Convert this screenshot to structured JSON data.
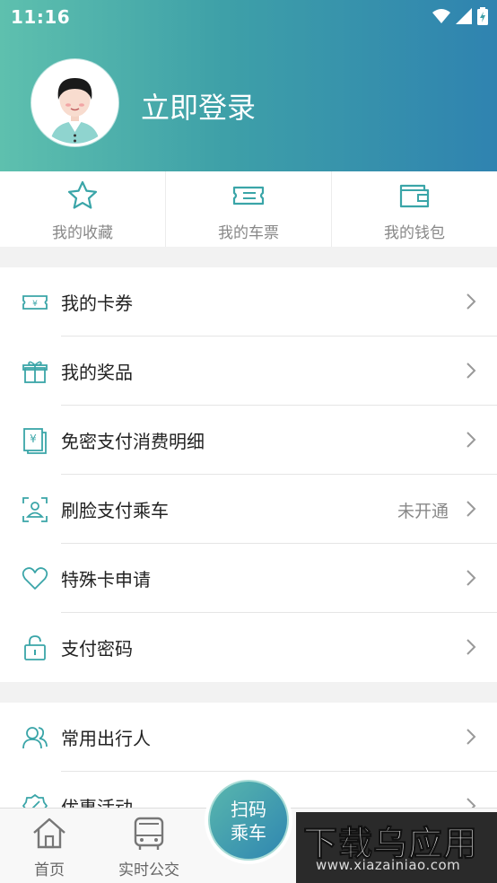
{
  "status_bar": {
    "time": "11:16"
  },
  "profile": {
    "login_label": "立即登录"
  },
  "quick_actions": [
    {
      "label": "我的收藏",
      "icon": "star-icon"
    },
    {
      "label": "我的车票",
      "icon": "ticket-icon"
    },
    {
      "label": "我的钱包",
      "icon": "wallet-icon"
    }
  ],
  "menu_group_1": [
    {
      "label": "我的卡券",
      "icon": "coupon-icon",
      "extra": ""
    },
    {
      "label": "我的奖品",
      "icon": "gift-icon",
      "extra": ""
    },
    {
      "label": "免密支付消费明细",
      "icon": "receipt-icon",
      "extra": ""
    },
    {
      "label": "刷脸支付乘车",
      "icon": "face-scan-icon",
      "extra": "未开通"
    },
    {
      "label": "特殊卡申请",
      "icon": "heart-icon",
      "extra": ""
    },
    {
      "label": "支付密码",
      "icon": "lock-icon",
      "extra": ""
    }
  ],
  "menu_group_2": [
    {
      "label": "常用出行人",
      "icon": "people-icon",
      "extra": ""
    },
    {
      "label": "优惠活动",
      "icon": "discount-icon",
      "extra": ""
    }
  ],
  "tabbar": {
    "home": "首页",
    "realtime_bus": "实时公交",
    "scan_line1": "扫码",
    "scan_line2": "乘车"
  },
  "watermark": {
    "title": "下载乌应用",
    "url": "www.xiazainiao.com"
  },
  "colors": {
    "accent": "#3aa5a8",
    "header_start": "#5ec0ae",
    "header_end": "#2f83b0"
  }
}
